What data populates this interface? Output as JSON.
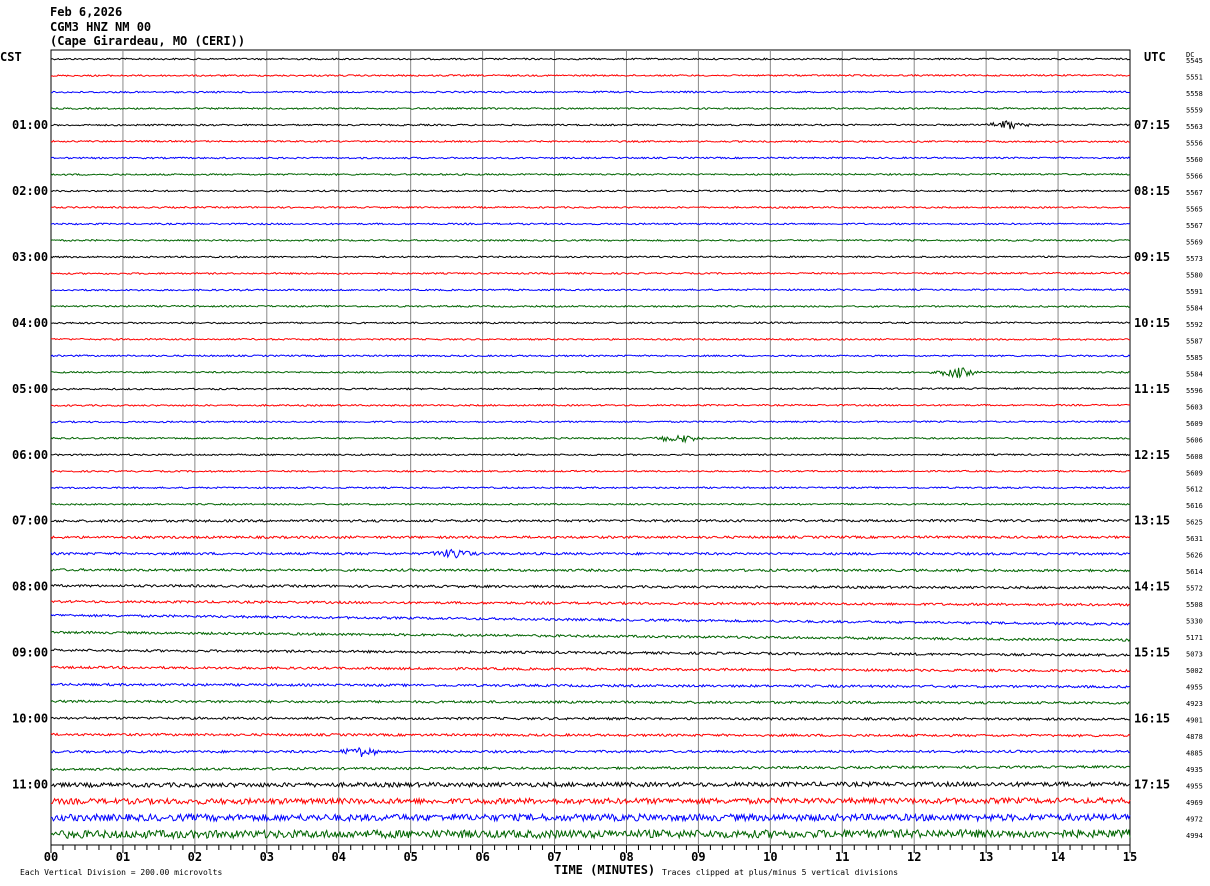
{
  "header": {
    "date": "Feb 6,2026",
    "station": "CGM3 HNZ NM 00",
    "location": "(Cape Girardeau, MO (CERI))"
  },
  "left_timezone": "CST",
  "right_timezone": "UTC",
  "dc_header": "DC",
  "footer": {
    "scale_note": "Each Vertical Division =  200.00 microvolts",
    "xlabel": "TIME (MINUTES)",
    "clip_note": "Traces clipped at plus/minus 5 vertical divisions"
  },
  "chart_data": {
    "type": "line",
    "title": "Feb 6,2026 CGM3 HNZ NM 00 (Cape Girardeau, MO (CERI))",
    "xlabel": "TIME (MINUTES)",
    "xlim": [
      0,
      15
    ],
    "x_ticks": [
      "00",
      "01",
      "02",
      "03",
      "04",
      "05",
      "06",
      "07",
      "08",
      "09",
      "10",
      "11",
      "12",
      "13",
      "14",
      "15"
    ],
    "grid": true,
    "trace_colors": [
      "#000000",
      "#ff0000",
      "#0000ff",
      "#006400"
    ],
    "left_hour_labels": [
      "01:00",
      "02:00",
      "03:00",
      "04:00",
      "05:00",
      "06:00",
      "07:00",
      "08:00",
      "09:00",
      "10:00",
      "11:00"
    ],
    "right_hour_labels": [
      "07:15",
      "08:15",
      "09:15",
      "10:15",
      "11:15",
      "12:15",
      "13:15",
      "14:15",
      "15:15",
      "16:15",
      "17:15"
    ],
    "dc_values": [
      5545,
      5551,
      5558,
      5559,
      5563,
      5556,
      5560,
      5566,
      5567,
      5565,
      5567,
      5569,
      5573,
      5580,
      5591,
      5584,
      5592,
      5587,
      5585,
      5584,
      5596,
      5603,
      5609,
      5606,
      5608,
      5609,
      5612,
      5616,
      5625,
      5631,
      5626,
      5614,
      5572,
      5508,
      5330,
      5171,
      5073,
      5002,
      4955,
      4923,
      4901,
      4878,
      4885,
      4935,
      4955,
      4969,
      4972,
      4994
    ],
    "events": [
      {
        "trace": 4,
        "minute": 13.3
      },
      {
        "trace": 19,
        "minute": 12.6
      },
      {
        "trace": 23,
        "minute": 8.7
      },
      {
        "trace": 30,
        "minute": 5.6
      },
      {
        "trace": 42,
        "minute": 4.3
      }
    ]
  }
}
